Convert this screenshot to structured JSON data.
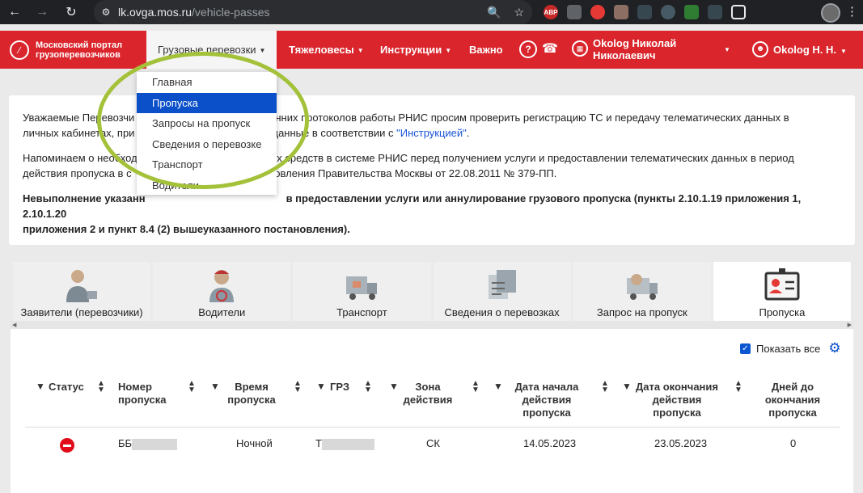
{
  "browser": {
    "url_host": "lk.ovga.mos.ru",
    "url_path": "/vehicle-passes",
    "ext_abp": "ABP"
  },
  "header": {
    "logo_line1": "Московский портал",
    "logo_line2": "грузоперевозчиков",
    "menu": [
      {
        "label": "Грузовые перевозки"
      },
      {
        "label": "Тяжеловесы"
      },
      {
        "label": "Инструкции"
      },
      {
        "label": "Важно"
      }
    ],
    "org_line1": "Okolog Николай",
    "org_line2": "Николаевич",
    "user": "Okolog Н. Н."
  },
  "dropdown": {
    "items": [
      "Главная",
      "Пропуска",
      "Запросы на пропуск",
      "Сведения о перевозке",
      "Транспорт",
      "Водители"
    ],
    "selected": "Пропуска"
  },
  "notice": {
    "p1_start": "Уважаемые Перевозчи",
    "p1_mid": "нутренних протоколов работы РНИС просим проверить регистрацию ТС и передачу телематических данных в",
    "p1_line2a": "личных кабинетах, при",
    "p1_line2b": "вать данные в соответствии с ",
    "p1_link": "\"Инструкцией\"",
    "p1_end": ".",
    "p2_line1a": "Напоминаем о необход",
    "p2_line1b": "ортных средств в системе РНИС перед получением услуги и предоставлении телематических данных в период",
    "p2_line2a": "действия пропуска в с",
    "p2_line2b": "становления Правительства Москвы от 22.08.2011 № 379-ПП.",
    "p3_line1a": "Невыполнение указанн",
    "p3_line1b": "в предоставлении услуги или аннулирование грузового пропуска (пункты 2.10.1.19 приложения 1, 2.10.1.20",
    "p3_line2": "приложения 2 и пункт 8.4 (2) вышеуказанного постановления)."
  },
  "tiles": [
    {
      "label": "Заявители (перевозчики)"
    },
    {
      "label": "Водители"
    },
    {
      "label": "Транспорт"
    },
    {
      "label": "Сведения о перевозках"
    },
    {
      "label": "Запрос на пропуск"
    },
    {
      "label": "Пропуска"
    }
  ],
  "table": {
    "show_all": "Показать все",
    "headers": {
      "status": "Статус",
      "number_1": "Номер",
      "number_2": "пропуска",
      "time_1": "Время",
      "time_2": "пропуска",
      "grz": "ГРЗ",
      "zone_1": "Зона",
      "zone_2": "действия",
      "start_1": "Дата начала",
      "start_2": "действия",
      "start_3": "пропуска",
      "end_1": "Дата окончания",
      "end_2": "действия",
      "end_3": "пропуска",
      "days_1": "Дней до",
      "days_2": "окончания",
      "days_3": "пропуска"
    },
    "rows": [
      {
        "number": "ББ",
        "time": "Ночной",
        "grz": "Т",
        "zone": "СК",
        "start": "14.05.2023",
        "end": "23.05.2023",
        "days": "0"
      }
    ]
  }
}
